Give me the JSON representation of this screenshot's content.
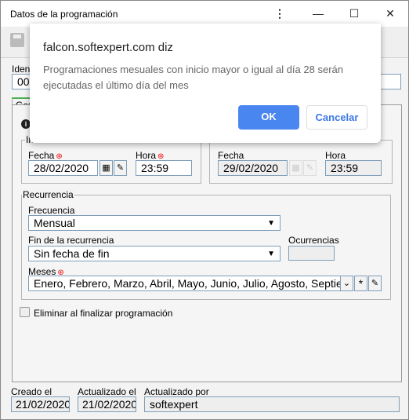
{
  "window": {
    "title": "Datos de la programación",
    "menu_icon": "kebab-icon",
    "minimize_icon": "minimize-icon",
    "maximize_icon": "maximize-icon",
    "close_icon": "close-icon"
  },
  "toolbar": {
    "save_icon": "save-icon"
  },
  "form": {
    "identifier_label_fragment": "Ident",
    "identifier_value_fragment": "000",
    "tab_general_fragment": "Gen",
    "start_fieldset_fragment": "In",
    "start": {
      "date_label": "Fecha",
      "date_value": "28/02/2020",
      "time_label": "Hora",
      "time_value": "23:59"
    },
    "next": {
      "date_label": "Fecha",
      "date_value": "29/02/2020",
      "time_label": "Hora",
      "time_value": "23:59"
    },
    "recurrence": {
      "legend": "Recurrencia",
      "frequency_label": "Frecuencia",
      "frequency_value": "Mensual",
      "end_label": "Fin de la recurrencia",
      "end_value": "Sin fecha de fin",
      "occurrences_label": "Ocurrencias",
      "occurrences_value": "",
      "months_label": "Meses",
      "months_value": "Enero, Febrero, Marzo, Abril, Mayo, Junio, Julio, Agosto, Septiembre"
    },
    "delete_on_finish_label": "Eliminar al finalizar programación",
    "delete_on_finish_checked": false,
    "created_label": "Creado el",
    "created_value": "21/02/2020",
    "updated_label": "Actualizado el",
    "updated_value": "21/02/2020",
    "updated_by_label": "Actualizado por",
    "updated_by_value": "softexpert"
  },
  "dialog": {
    "title": "falcon.softexpert.com diz",
    "message_line1": "Programaciones mesuales con inicio mayor o igual al día 28 serán",
    "message_line2": "ejecutadas el último día del mes",
    "ok_label": "OK",
    "cancel_label": "Cancelar",
    "ok_color": "#4a86f0"
  }
}
